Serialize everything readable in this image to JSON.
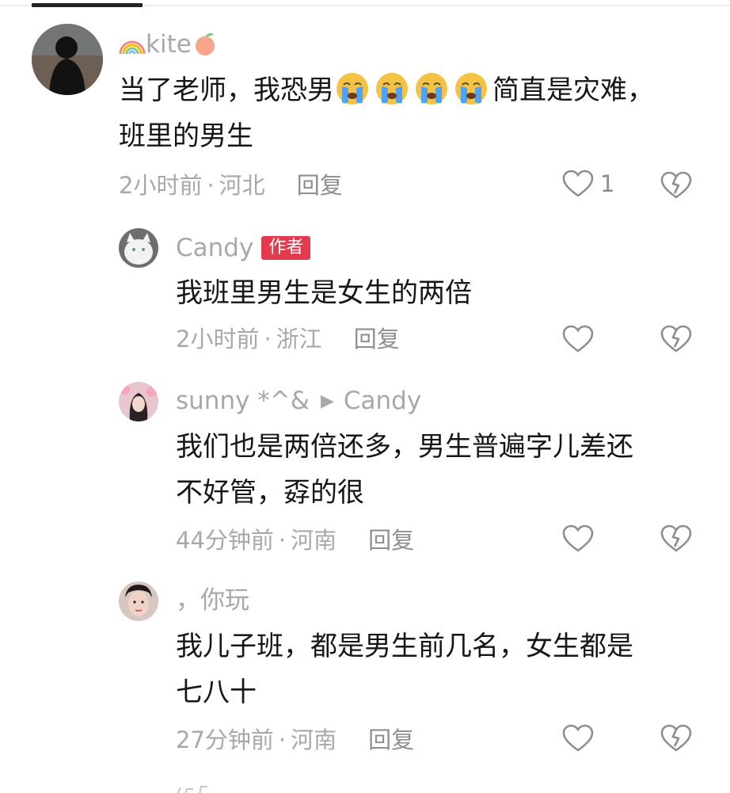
{
  "comments": [
    {
      "name": "kite",
      "text_a": "当了老师，我恐男",
      "text_b": "简直是灾难，",
      "text_c": "班里的男生",
      "time": "2小时前",
      "location": "河北",
      "reply_label": "回复",
      "likes": "1"
    },
    {
      "name": "Candy",
      "badge": "作者",
      "text": "我班里男生是女生的两倍",
      "time": "2小时前",
      "location": "浙江",
      "reply_label": "回复"
    },
    {
      "name": "sunny *^&",
      "reply_to": "Candy",
      "text_a": "我们也是两倍还多，男生普遍字儿差还",
      "text_b": "不好管，孬的很",
      "time": "44分钟前",
      "location": "河南",
      "reply_label": "回复"
    },
    {
      "name": "，你玩",
      "text_a": "我儿子班，都是男生前几名，女生都是",
      "text_b": "七八十",
      "time": "27分钟前",
      "location": "河南",
      "reply_label": "回复"
    }
  ],
  "meta_separator": "·",
  "icons": {
    "like": "heart-outline-icon",
    "dislike": "broken-heart-icon",
    "emoji": "loudly-crying-face-emoji",
    "rainbow": "rainbow-emoji",
    "peach": "peach-emoji",
    "reply_arrow": "play-arrow-icon"
  },
  "colors": {
    "badge_bg": "#e5394d",
    "meta_text": "#a8a8a8",
    "body_text": "#161616"
  }
}
